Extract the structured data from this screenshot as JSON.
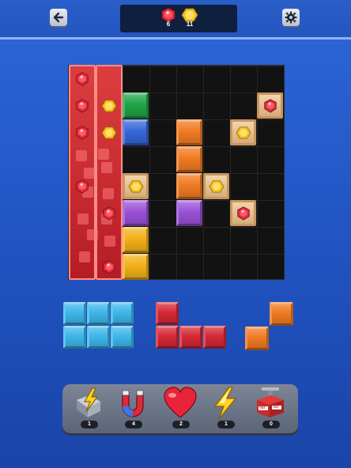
{
  "header": {
    "back_icon": "arrow-left-icon",
    "settings_icon": "gear-icon",
    "ruby_count": "6",
    "gold_count": "11"
  },
  "colors": {
    "green": "#20a447",
    "blue": "#3467d8",
    "orange": "#f07a22",
    "purple": "#9a50d6",
    "yellow": "#f2b019",
    "red": "#d42836",
    "cyan": "#3db6ea",
    "crate": "#e6c08e"
  },
  "powerups": [
    {
      "name": "block-breaker",
      "icon": "hammer-bolt-icon",
      "count": "1"
    },
    {
      "name": "magnet",
      "icon": "magnet-icon",
      "count": "4"
    },
    {
      "name": "heart",
      "icon": "heart-icon",
      "count": "2"
    },
    {
      "name": "lightning",
      "icon": "lightning-icon",
      "count": "1"
    },
    {
      "name": "tnt",
      "icon": "tnt-icon",
      "count": "0",
      "label": "TNT"
    }
  ]
}
